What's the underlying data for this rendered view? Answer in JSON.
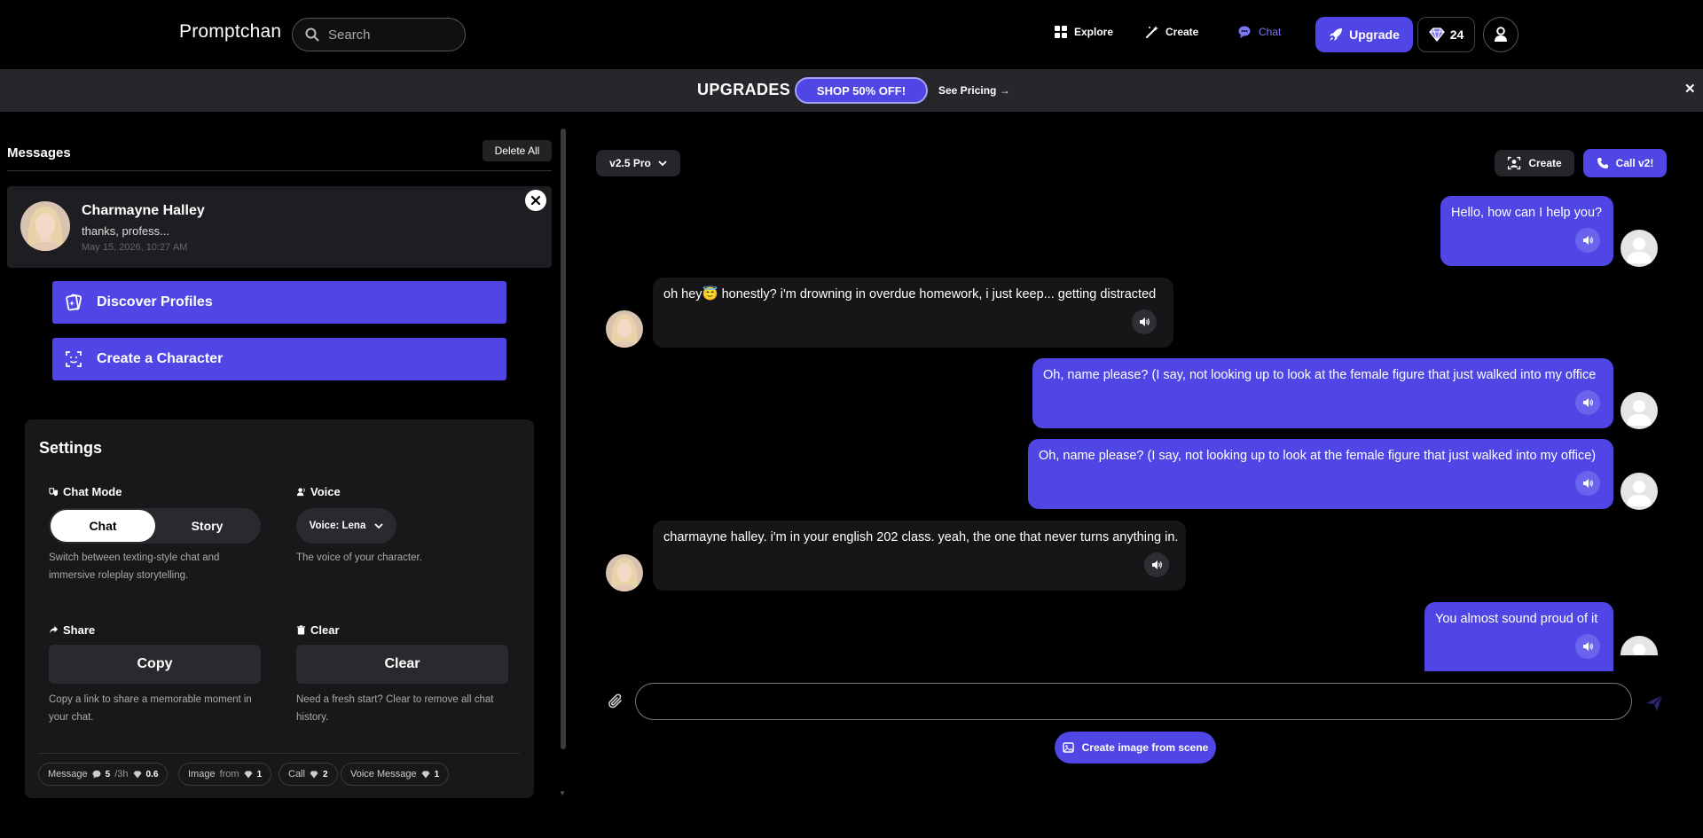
{
  "header": {
    "logo": "Promptchan",
    "search_placeholder": "Search",
    "nav": {
      "explore": "Explore",
      "create": "Create",
      "chat": "Chat"
    },
    "upgrade": "Upgrade",
    "gems": "24"
  },
  "banner": {
    "title": "UPGRADES",
    "shop": "SHOP 50% OFF!",
    "pricing": "See Pricing →",
    "close": "✕"
  },
  "sidebar": {
    "title": "Messages",
    "delete_all": "Delete All",
    "conversation": {
      "name": "Charmayne Halley",
      "last_message": "thanks, profess...",
      "time": "May 15, 2026, 10:27 AM"
    },
    "discover": "Discover Profiles",
    "create_character": "Create a Character"
  },
  "settings": {
    "title": "Settings",
    "chat_mode": {
      "label": "Chat Mode",
      "options": [
        "Chat",
        "Story"
      ],
      "selected": "Chat",
      "desc": "Switch between texting-style chat and immersive roleplay storytelling."
    },
    "voice": {
      "label": "Voice",
      "value": "Voice: Lena",
      "desc": "The voice of your character."
    },
    "share": {
      "label": "Share",
      "button": "Copy",
      "desc": "Copy a link to share a memorable moment in your chat."
    },
    "clear": {
      "label": "Clear",
      "button": "Clear",
      "desc": "Need a fresh start? Clear to remove all chat history."
    },
    "costs": {
      "message": {
        "label": "Message",
        "count": "5",
        "per": "/3h",
        "cost": "0.6"
      },
      "image": {
        "label": "Image",
        "from": "from",
        "cost": "1"
      },
      "call": {
        "label": "Call",
        "cost": "2"
      },
      "voice_message": {
        "label": "Voice Message",
        "cost": "1"
      }
    }
  },
  "chat": {
    "model": "v2.5 Pro",
    "create": "Create",
    "call": "Call v2!",
    "messages": [
      {
        "role": "user",
        "text": "Hello, how can I help you?"
      },
      {
        "role": "bot",
        "text": "oh hey😇 honestly? i'm drowning in overdue homework, i just keep... getting distracted"
      },
      {
        "role": "user",
        "text": "Oh, name please? (I say, not looking up to look at the female figure that just walked into my office"
      },
      {
        "role": "user",
        "text": "Oh, name please? (I say, not looking up to look at the female figure that just walked into my office)"
      },
      {
        "role": "bot",
        "text": "charmayne halley. i'm in your english 202 class. yeah, the one that never turns anything in."
      },
      {
        "role": "user",
        "text": "You almost sound proud of it"
      }
    ],
    "input_placeholder": "",
    "create_scene": "Create image from scene"
  },
  "colors": {
    "accent": "#4f46e5",
    "background": "#000000",
    "panel": "#18181b",
    "active_nav": "#7c76f5"
  }
}
